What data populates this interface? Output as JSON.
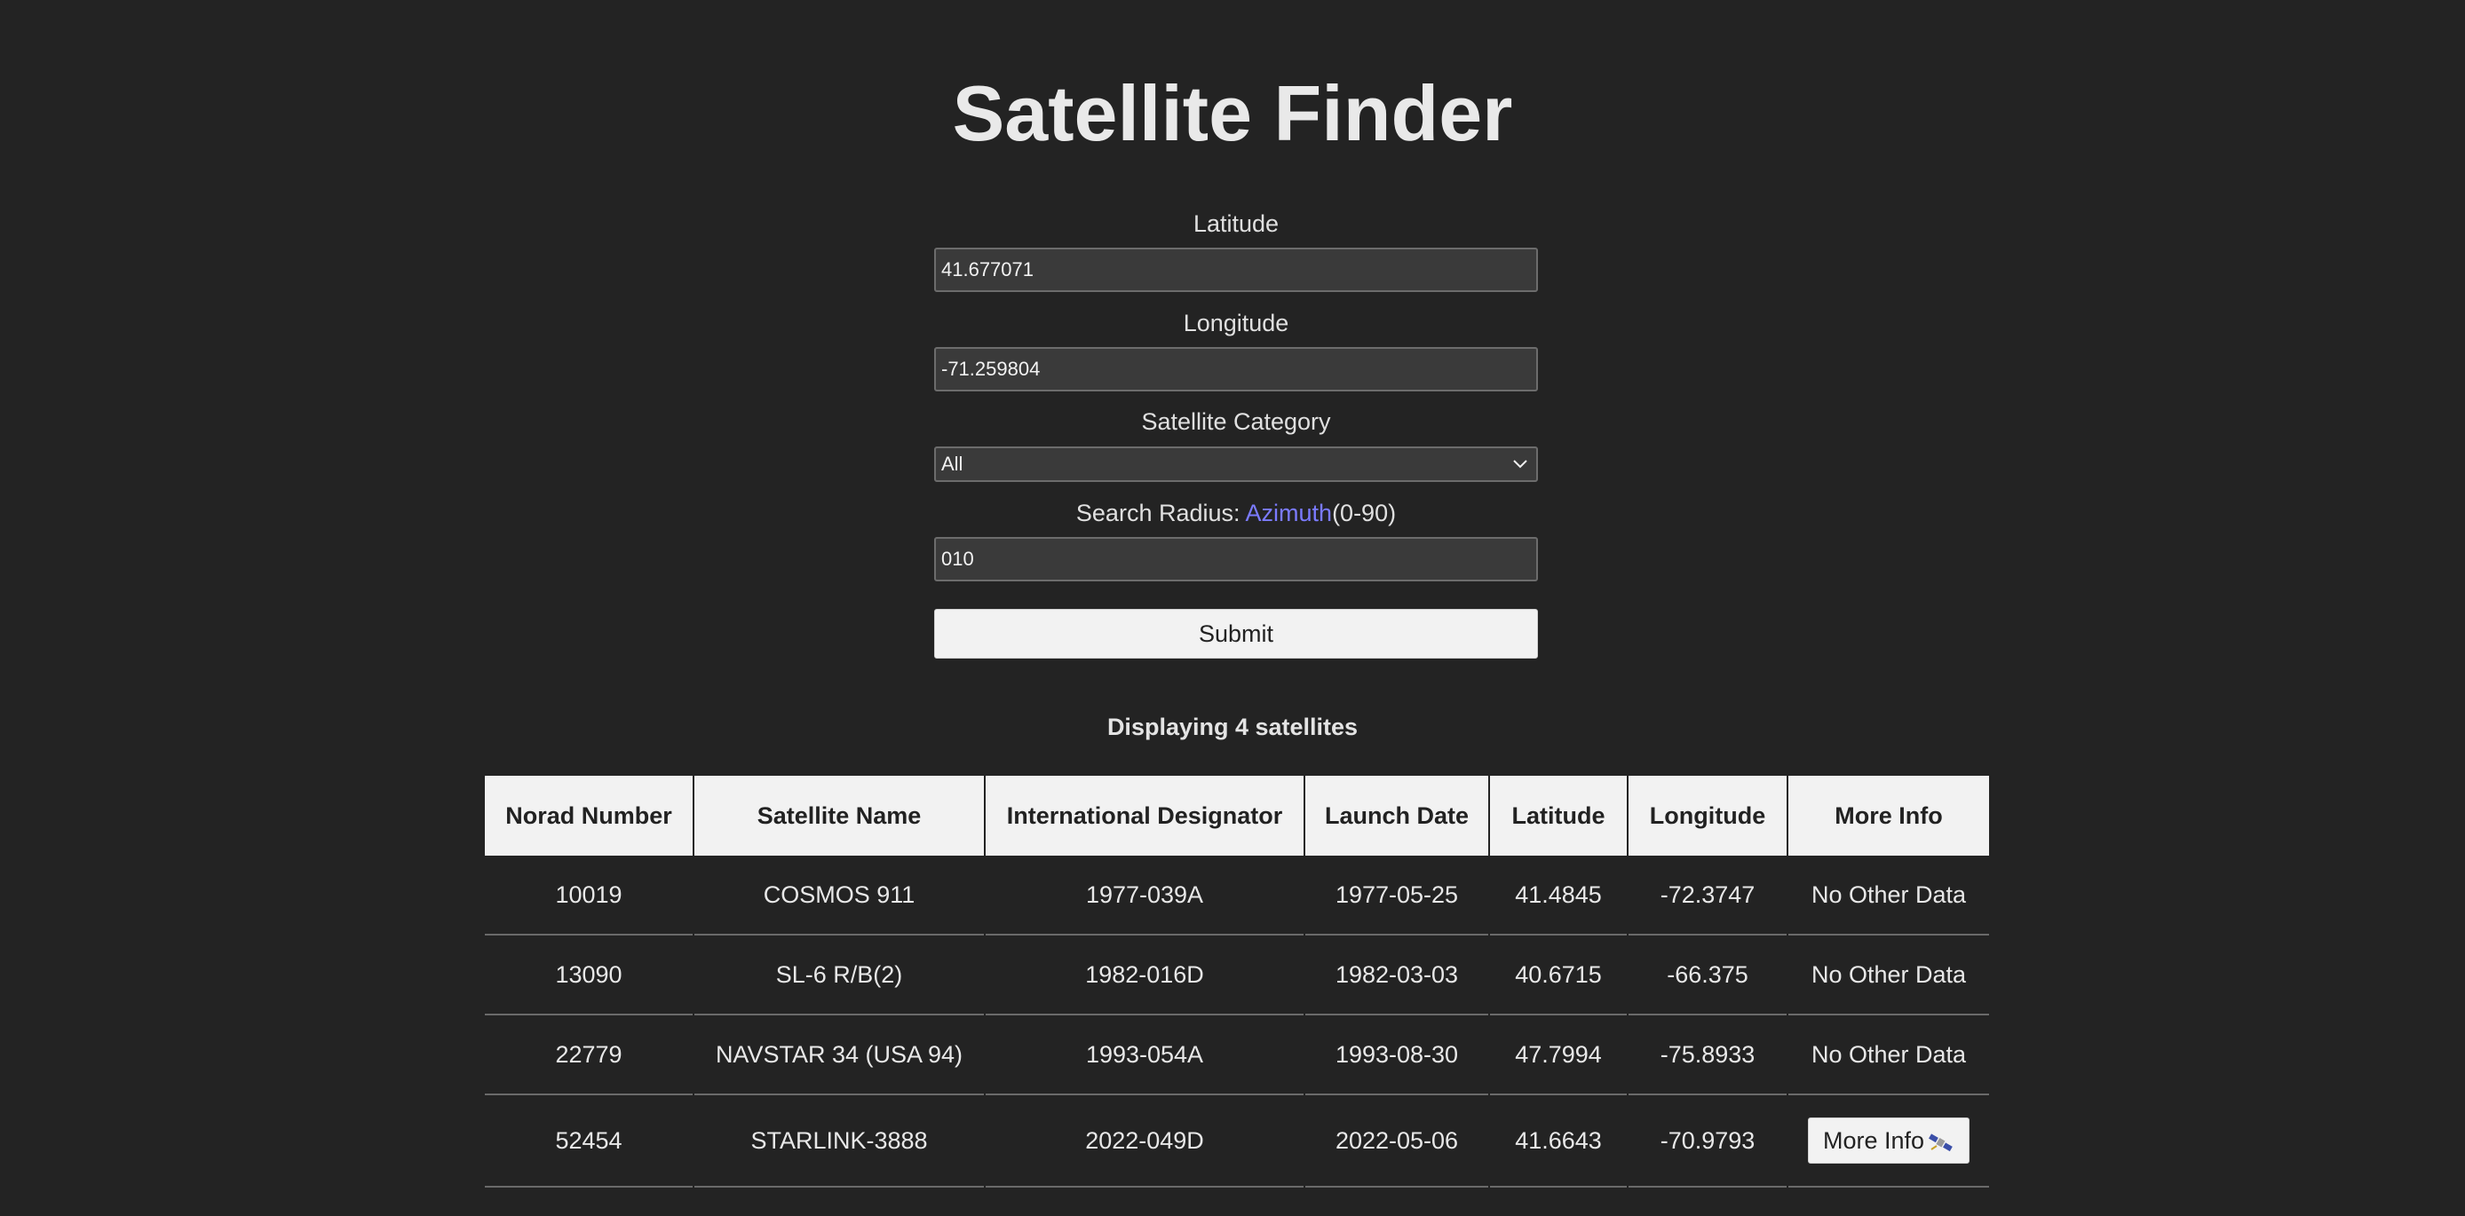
{
  "page": {
    "title": "Satellite Finder"
  },
  "form": {
    "latitude_label": "Latitude",
    "latitude_value": "41.677071",
    "longitude_label": "Longitude",
    "longitude_value": "-71.259804",
    "category_label": "Satellite Category",
    "category_value": "All",
    "radius_label_prefix": "Search Radius: ",
    "radius_link": "Azimuth",
    "radius_label_suffix": "(0-90)",
    "radius_value": "010",
    "submit_label": "Submit"
  },
  "results": {
    "count_text": "Displaying 4 satellites",
    "columns": [
      "Norad Number",
      "Satellite Name",
      "International Designator",
      "Launch Date",
      "Latitude",
      "Longitude",
      "More Info"
    ],
    "rows": [
      {
        "norad": "10019",
        "name": "COSMOS 911",
        "designator": "1977-039A",
        "launch": "1977-05-25",
        "lat": "41.4845",
        "lon": "-72.3747",
        "info": "No Other Data"
      },
      {
        "norad": "13090",
        "name": "SL-6 R/B(2)",
        "designator": "1982-016D",
        "launch": "1982-03-03",
        "lat": "40.6715",
        "lon": "-66.375",
        "info": "No Other Data"
      },
      {
        "norad": "22779",
        "name": "NAVSTAR 34 (USA 94)",
        "designator": "1993-054A",
        "launch": "1993-08-30",
        "lat": "47.7994",
        "lon": "-75.8933",
        "info": "No Other Data"
      },
      {
        "norad": "52454",
        "name": "STARLINK-3888",
        "designator": "2022-049D",
        "launch": "2022-05-06",
        "lat": "41.6643",
        "lon": "-70.9793",
        "info_button": "More Info",
        "info_icon": "satellite-icon"
      }
    ]
  }
}
